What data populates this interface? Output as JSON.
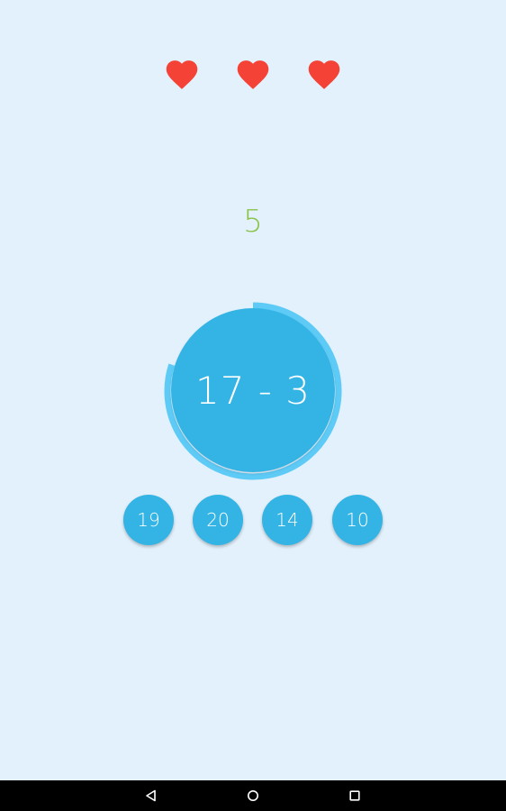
{
  "lives": {
    "count": 3,
    "icon": "heart-icon",
    "color": "#f44336"
  },
  "score": {
    "value": "5",
    "color": "#8bc34a"
  },
  "question": {
    "text": "17 - 3",
    "color": "#33b4e5",
    "timer_color": "#5ecbf7",
    "timer_remaining_fraction": 0.8
  },
  "answers": {
    "options": [
      "19",
      "20",
      "14",
      "10"
    ],
    "color": "#33b4e5"
  },
  "nav_bar": {
    "background": "#000000",
    "back_icon": "back-triangle-icon",
    "home_icon": "home-circle-icon",
    "recents_icon": "recents-square-icon"
  }
}
